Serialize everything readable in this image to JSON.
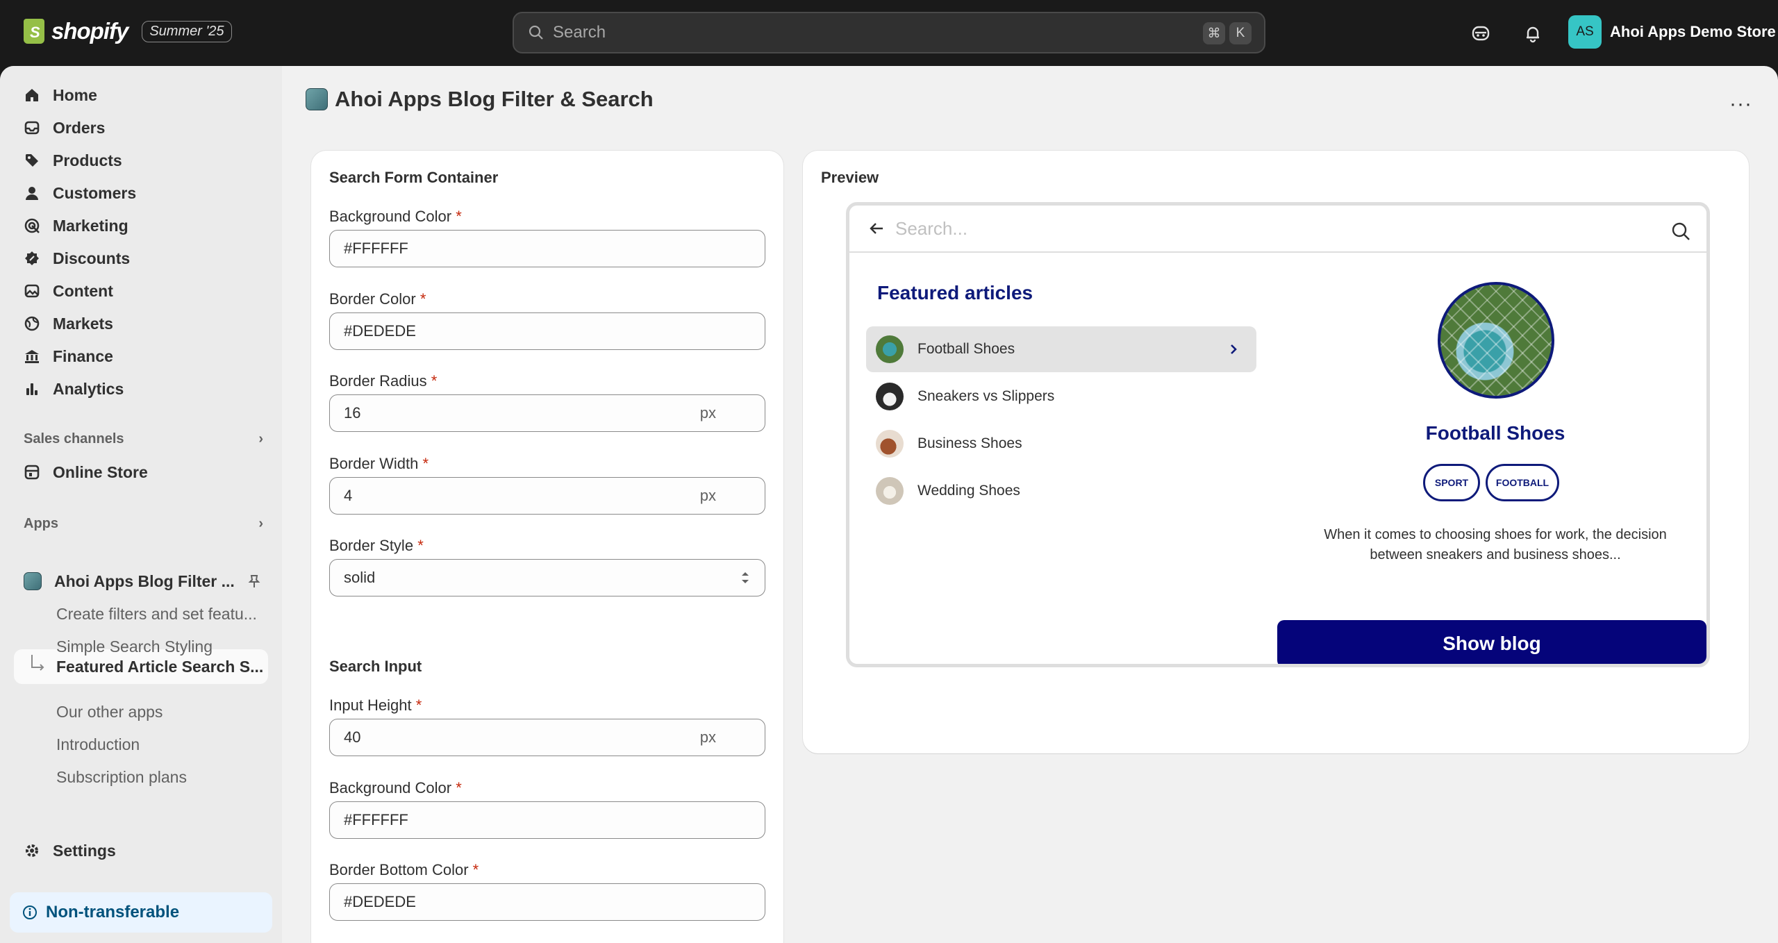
{
  "topbar": {
    "brand": "shopify",
    "edition_badge": "Summer '25",
    "search_placeholder": "Search",
    "shortcut_cmd": "⌘",
    "shortcut_key": "K",
    "store_initials": "AS",
    "store_name": "Ahoi Apps Demo Store"
  },
  "sidebar": {
    "nav": [
      {
        "label": "Home",
        "icon": "home-icon"
      },
      {
        "label": "Orders",
        "icon": "inbox-icon"
      },
      {
        "label": "Products",
        "icon": "tag-icon"
      },
      {
        "label": "Customers",
        "icon": "person-icon"
      },
      {
        "label": "Marketing",
        "icon": "target-icon"
      },
      {
        "label": "Discounts",
        "icon": "discount-icon"
      },
      {
        "label": "Content",
        "icon": "image-icon"
      },
      {
        "label": "Markets",
        "icon": "globe-icon"
      },
      {
        "label": "Finance",
        "icon": "bank-icon"
      },
      {
        "label": "Analytics",
        "icon": "bar-chart-icon"
      }
    ],
    "sales_channels_heading": "Sales channels",
    "online_store": "Online Store",
    "apps_heading": "Apps",
    "app_name": "Ahoi Apps Blog Filter ...",
    "app_subitems": [
      "Create filters and set featu...",
      "Simple Search Styling",
      "Featured Article Search S...",
      "Our other apps",
      "Introduction",
      "Subscription plans"
    ],
    "settings": "Settings",
    "non_transferable": "Non-transferable"
  },
  "page": {
    "title": "Ahoi Apps Blog Filter & Search",
    "more": "···"
  },
  "form": {
    "section1_title": "Search Form Container",
    "bg_color_label": "Background Color",
    "bg_color_value": "#FFFFFF",
    "border_color_label": "Border Color",
    "border_color_value": "#DEDEDE",
    "border_radius_label": "Border Radius",
    "border_radius_value": "16",
    "border_width_label": "Border Width",
    "border_width_value": "4",
    "border_style_label": "Border Style",
    "border_style_value": "solid",
    "unit": "px",
    "required": "*",
    "section2_title": "Search Input",
    "input_height_label": "Input Height",
    "input_height_value": "40",
    "input_bg_label": "Background Color",
    "input_bg_value": "#FFFFFF",
    "border_bottom_label": "Border Bottom Color",
    "border_bottom_value": "#DEDEDE"
  },
  "preview": {
    "heading": "Preview",
    "search_placeholder": "Search...",
    "featured_heading": "Featured articles",
    "articles": [
      "Football Shoes",
      "Sneakers vs Slippers",
      "Business Shoes",
      "Wedding Shoes"
    ],
    "selected_title": "Football Shoes",
    "tags": [
      "SPORT",
      "FOOTBALL"
    ],
    "description": "When it comes to choosing shoes for work, the decision between sneakers and business shoes...",
    "button": "Show blog"
  },
  "colors": {
    "accent": "#0E1A7A",
    "button": "#05047A",
    "topbar": "#1A1A1A"
  }
}
